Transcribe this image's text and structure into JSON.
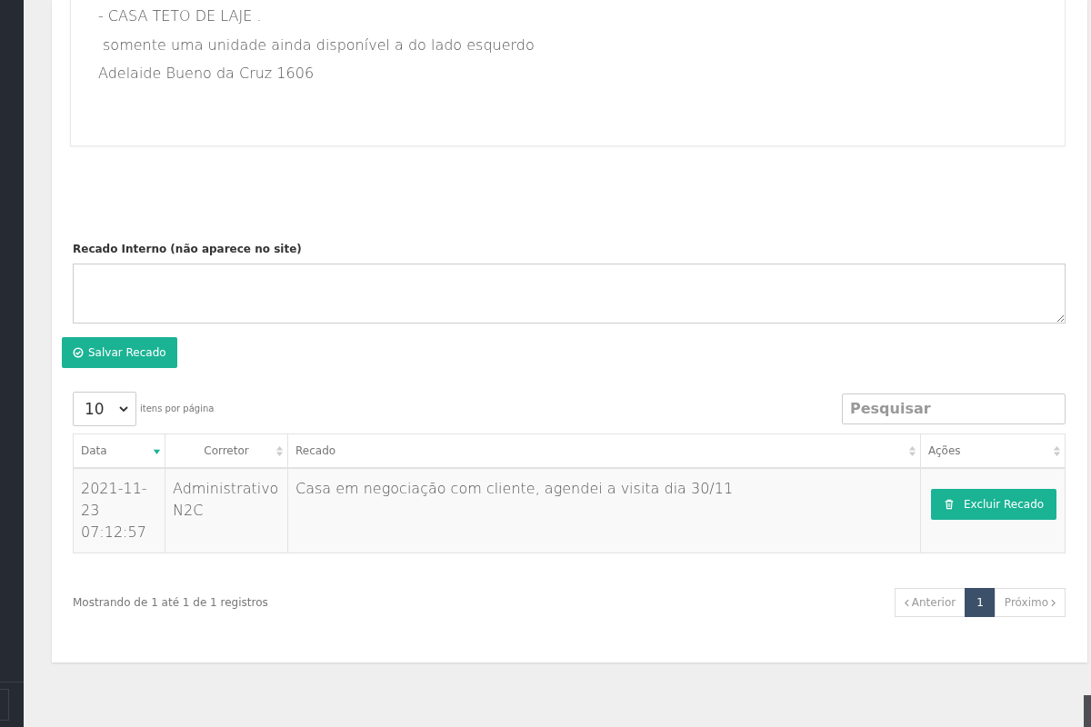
{
  "description": {
    "lines": [
      "- CASA TETO DE LAJE .",
      "somente uma unidade ainda disponível a do lado esquerdo",
      "Adelaide Bueno da Cruz 1606"
    ]
  },
  "note_form": {
    "label": "Recado Interno (não aparece no site)",
    "save_button": "Salvar Recado"
  },
  "table_controls": {
    "page_size": "10",
    "page_size_label": "itens por página",
    "search": {
      "placeholder": "Pesquisar"
    }
  },
  "table": {
    "columns": [
      {
        "label": "Data",
        "sorted": true
      },
      {
        "label": "Corretor",
        "sorted": false
      },
      {
        "label": "Recado",
        "sorted": false
      },
      {
        "label": "Ações",
        "sorted": false
      }
    ],
    "rows": [
      {
        "date": "2021-11-23 07:12:57",
        "broker": "Administrativo N2C",
        "note": "Casa em negociação com cliente, agendei a visita dia 30/11",
        "action": "Excluir Recado"
      }
    ]
  },
  "footer": {
    "info": "Mostrando de 1 até 1 de 1 registros",
    "previous": "Anterior",
    "next": "Próximo",
    "pages": [
      {
        "label": "1",
        "selected": true
      }
    ]
  }
}
